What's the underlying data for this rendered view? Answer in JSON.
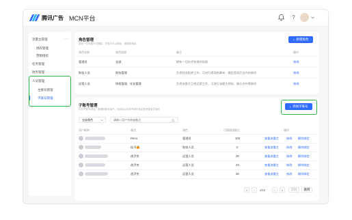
{
  "header": {
    "brand": "腾讯广告",
    "platform": "MCN平台",
    "help_label": "?"
  },
  "sidebar": {
    "items": [
      {
        "label": "流量主管理",
        "expand_symbol": "—"
      },
      {
        "label": "授权管理"
      },
      {
        "label": "营销授权"
      },
      {
        "label": "任务管理"
      },
      {
        "label": "财务管理"
      },
      {
        "label": "人员管理"
      },
      {
        "label": "主账号管理"
      },
      {
        "label": "子账号管理"
      }
    ]
  },
  "roles": {
    "title": "角色管理",
    "subtitle": "角色一旦设置不可删除，但显示可以修改，请谨慎添加",
    "new_button": "新增角色",
    "columns": [
      "角色名称",
      "角色权限",
      "备注",
      "操作"
    ],
    "rows": [
      {
        "name": "管理员",
        "perm": "全部",
        "note": "拥有一切技术和操作权限",
        "action": "修改"
      },
      {
        "name": "财务人员",
        "perm": "财务管理",
        "note": "负责财务相关工作，可进行提现结算单、确定提现后台内的操作",
        "action": "修改"
      },
      {
        "name": "运营人员",
        "perm": "授权管理、任务管理",
        "note": "负责流量主日常运营工作，可进行流量主授权、确认合作等操作",
        "action": "修改"
      }
    ]
  },
  "subaccounts": {
    "title": "子账号管理",
    "subtitle": "可对子账号添加、管理和账号操作，添加后以手机号或外部主账号登录并操作",
    "new_button": "添加子账号",
    "filter_value": "全部角色",
    "search_placeholder": "请输入用户名称或备注",
    "columns": [
      "用户昵称",
      "备注",
      "角色",
      "可管理流量主",
      "操作"
    ],
    "rows": [
      {
        "note": "Reno",
        "role": "管理员",
        "count": "100",
        "a1": "查看流量主",
        "a2": "修改",
        "a3": "解除绑定"
      },
      {
        "note": "桔子🍊",
        "role": "财务人员",
        "count": "0",
        "a1": "查看流量主",
        "a2": "修改",
        "a3": "解除绑定"
      },
      {
        "note": "途尹克",
        "role": "运营人员",
        "count": "35",
        "a1": "查看流量主",
        "a2": "修改",
        "a3": "解除绑定"
      },
      {
        "note": "途尹克",
        "role": "运营人员",
        "count": "33",
        "a1": "查看流量主",
        "a2": "修改",
        "a3": "解除绑定"
      },
      {
        "note": "途尹克",
        "role": "运营人员",
        "count": "35",
        "a1": "查看流量主",
        "a2": "修改",
        "a3": "解除绑定"
      }
    ],
    "pagination": {
      "first": "«",
      "prev": "‹",
      "page_text": "2/10",
      "next": "›",
      "last": "»",
      "goto_placeholder": "页码",
      "jump_label": "跳转"
    }
  },
  "colors": {
    "accent": "#2f6bff",
    "highlight": "#2fb44a",
    "page_bg": "#f5f6f8"
  },
  "icons": [
    "logo-mark",
    "bell-icon",
    "help-icon",
    "chevron-down-icon",
    "plus-icon",
    "search-icon"
  ]
}
